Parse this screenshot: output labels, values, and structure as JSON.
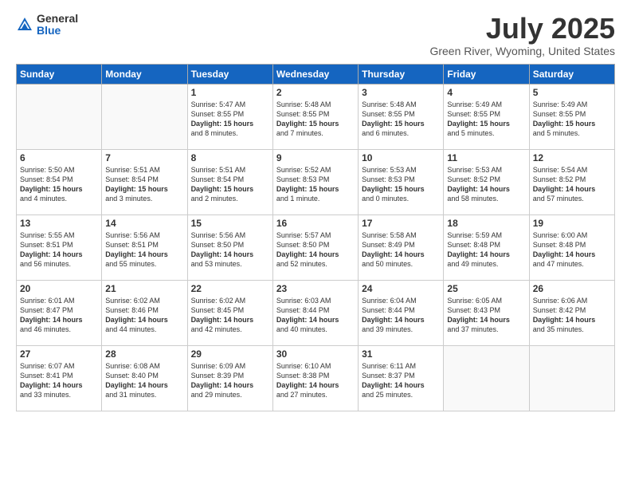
{
  "logo": {
    "general": "General",
    "blue": "Blue"
  },
  "title": "July 2025",
  "subtitle": "Green River, Wyoming, United States",
  "days_of_week": [
    "Sunday",
    "Monday",
    "Tuesday",
    "Wednesday",
    "Thursday",
    "Friday",
    "Saturday"
  ],
  "weeks": [
    [
      {
        "day": "",
        "content": ""
      },
      {
        "day": "",
        "content": ""
      },
      {
        "day": "1",
        "content": "Sunrise: 5:47 AM\nSunset: 8:55 PM\nDaylight: 15 hours\nand 8 minutes."
      },
      {
        "day": "2",
        "content": "Sunrise: 5:48 AM\nSunset: 8:55 PM\nDaylight: 15 hours\nand 7 minutes."
      },
      {
        "day": "3",
        "content": "Sunrise: 5:48 AM\nSunset: 8:55 PM\nDaylight: 15 hours\nand 6 minutes."
      },
      {
        "day": "4",
        "content": "Sunrise: 5:49 AM\nSunset: 8:55 PM\nDaylight: 15 hours\nand 5 minutes."
      },
      {
        "day": "5",
        "content": "Sunrise: 5:49 AM\nSunset: 8:55 PM\nDaylight: 15 hours\nand 5 minutes."
      }
    ],
    [
      {
        "day": "6",
        "content": "Sunrise: 5:50 AM\nSunset: 8:54 PM\nDaylight: 15 hours\nand 4 minutes."
      },
      {
        "day": "7",
        "content": "Sunrise: 5:51 AM\nSunset: 8:54 PM\nDaylight: 15 hours\nand 3 minutes."
      },
      {
        "day": "8",
        "content": "Sunrise: 5:51 AM\nSunset: 8:54 PM\nDaylight: 15 hours\nand 2 minutes."
      },
      {
        "day": "9",
        "content": "Sunrise: 5:52 AM\nSunset: 8:53 PM\nDaylight: 15 hours\nand 1 minute."
      },
      {
        "day": "10",
        "content": "Sunrise: 5:53 AM\nSunset: 8:53 PM\nDaylight: 15 hours\nand 0 minutes."
      },
      {
        "day": "11",
        "content": "Sunrise: 5:53 AM\nSunset: 8:52 PM\nDaylight: 14 hours\nand 58 minutes."
      },
      {
        "day": "12",
        "content": "Sunrise: 5:54 AM\nSunset: 8:52 PM\nDaylight: 14 hours\nand 57 minutes."
      }
    ],
    [
      {
        "day": "13",
        "content": "Sunrise: 5:55 AM\nSunset: 8:51 PM\nDaylight: 14 hours\nand 56 minutes."
      },
      {
        "day": "14",
        "content": "Sunrise: 5:56 AM\nSunset: 8:51 PM\nDaylight: 14 hours\nand 55 minutes."
      },
      {
        "day": "15",
        "content": "Sunrise: 5:56 AM\nSunset: 8:50 PM\nDaylight: 14 hours\nand 53 minutes."
      },
      {
        "day": "16",
        "content": "Sunrise: 5:57 AM\nSunset: 8:50 PM\nDaylight: 14 hours\nand 52 minutes."
      },
      {
        "day": "17",
        "content": "Sunrise: 5:58 AM\nSunset: 8:49 PM\nDaylight: 14 hours\nand 50 minutes."
      },
      {
        "day": "18",
        "content": "Sunrise: 5:59 AM\nSunset: 8:48 PM\nDaylight: 14 hours\nand 49 minutes."
      },
      {
        "day": "19",
        "content": "Sunrise: 6:00 AM\nSunset: 8:48 PM\nDaylight: 14 hours\nand 47 minutes."
      }
    ],
    [
      {
        "day": "20",
        "content": "Sunrise: 6:01 AM\nSunset: 8:47 PM\nDaylight: 14 hours\nand 46 minutes."
      },
      {
        "day": "21",
        "content": "Sunrise: 6:02 AM\nSunset: 8:46 PM\nDaylight: 14 hours\nand 44 minutes."
      },
      {
        "day": "22",
        "content": "Sunrise: 6:02 AM\nSunset: 8:45 PM\nDaylight: 14 hours\nand 42 minutes."
      },
      {
        "day": "23",
        "content": "Sunrise: 6:03 AM\nSunset: 8:44 PM\nDaylight: 14 hours\nand 40 minutes."
      },
      {
        "day": "24",
        "content": "Sunrise: 6:04 AM\nSunset: 8:44 PM\nDaylight: 14 hours\nand 39 minutes."
      },
      {
        "day": "25",
        "content": "Sunrise: 6:05 AM\nSunset: 8:43 PM\nDaylight: 14 hours\nand 37 minutes."
      },
      {
        "day": "26",
        "content": "Sunrise: 6:06 AM\nSunset: 8:42 PM\nDaylight: 14 hours\nand 35 minutes."
      }
    ],
    [
      {
        "day": "27",
        "content": "Sunrise: 6:07 AM\nSunset: 8:41 PM\nDaylight: 14 hours\nand 33 minutes."
      },
      {
        "day": "28",
        "content": "Sunrise: 6:08 AM\nSunset: 8:40 PM\nDaylight: 14 hours\nand 31 minutes."
      },
      {
        "day": "29",
        "content": "Sunrise: 6:09 AM\nSunset: 8:39 PM\nDaylight: 14 hours\nand 29 minutes."
      },
      {
        "day": "30",
        "content": "Sunrise: 6:10 AM\nSunset: 8:38 PM\nDaylight: 14 hours\nand 27 minutes."
      },
      {
        "day": "31",
        "content": "Sunrise: 6:11 AM\nSunset: 8:37 PM\nDaylight: 14 hours\nand 25 minutes."
      },
      {
        "day": "",
        "content": ""
      },
      {
        "day": "",
        "content": ""
      }
    ]
  ]
}
